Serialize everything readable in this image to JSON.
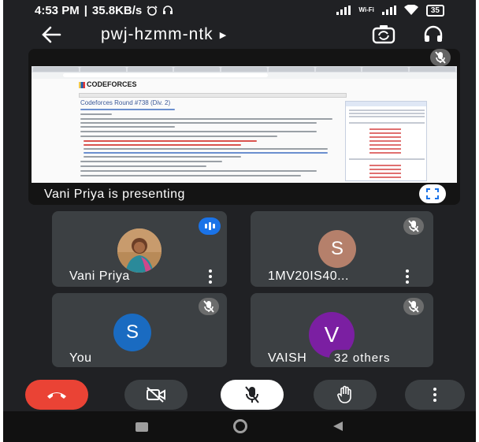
{
  "status_bar": {
    "time": "4:53 PM",
    "separator": "|",
    "speed": "35.8KB/s",
    "wifi_label": "Wi-Fi",
    "battery": "35"
  },
  "header": {
    "meeting_code": "pwj-hzmm-ntk"
  },
  "presentation": {
    "presenter_label": "Vani Priya is presenting",
    "shared_page_title": "Codeforces Round #738 (Div. 2)",
    "shared_site_logo": "CODEFORCES"
  },
  "participants": [
    {
      "name": "Vani Priya",
      "avatar_letter": "",
      "avatar_color": "#c8a87a",
      "muted": false,
      "speaking": true
    },
    {
      "name": "1MV20IS40...",
      "avatar_letter": "S",
      "avatar_color": "#b5806b",
      "muted": true,
      "speaking": false
    },
    {
      "name": "You",
      "avatar_letter": "S",
      "avatar_color": "#1a6bc1",
      "muted": true,
      "speaking": false
    },
    {
      "name": "VAISH",
      "avatar_letter": "V",
      "avatar_color": "#7b1fa2",
      "muted": true,
      "speaking": false,
      "others_count": "32",
      "others_label": "others"
    }
  ],
  "controls": {
    "end_call_color": "#ea4335",
    "icons": [
      "end-call-icon",
      "camera-off-icon",
      "mic-off-icon",
      "raise-hand-icon",
      "more-options-icon"
    ]
  },
  "nav": {
    "icons": [
      "recents-icon",
      "home-icon",
      "back-nav-icon"
    ]
  }
}
